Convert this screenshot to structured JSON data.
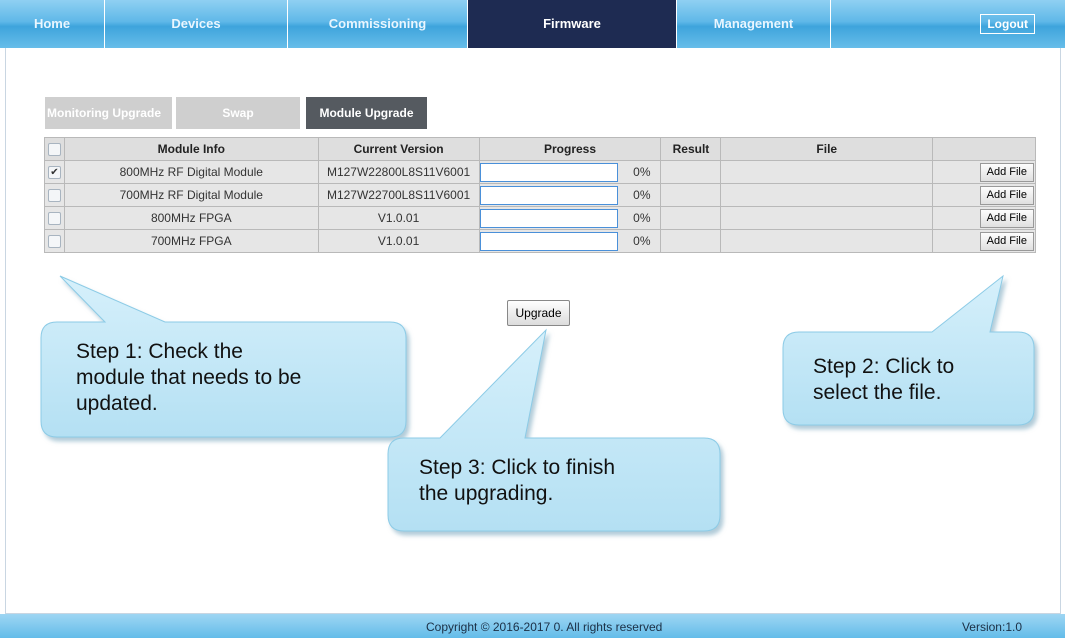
{
  "nav": {
    "home": "Home",
    "devices": "Devices",
    "commissioning": "Commissioning",
    "firmware": "Firmware",
    "management": "Management",
    "logout": "Logout"
  },
  "subtabs": [
    "Monitoring Upgrade",
    "Swap",
    "Module Upgrade"
  ],
  "table": {
    "headers": {
      "module_info": "Module Info",
      "current_version": "Current Version",
      "progress": "Progress",
      "result": "Result",
      "file": "File"
    },
    "rows": [
      {
        "checked": true,
        "module": "800MHz RF Digital Module",
        "version": "M127W22800L8S11V6001",
        "progress": "0%",
        "progress_fraction": 0,
        "result": "",
        "file": "",
        "add_file": "Add File"
      },
      {
        "checked": false,
        "module": "700MHz RF Digital Module",
        "version": "M127W22700L8S11V6001",
        "progress": "0%",
        "progress_fraction": 0,
        "result": "",
        "file": "",
        "add_file": "Add File"
      },
      {
        "checked": false,
        "module": "800MHz FPGA",
        "version": "V1.0.01",
        "progress": "0%",
        "progress_fraction": 0,
        "result": "",
        "file": "",
        "add_file": "Add File"
      },
      {
        "checked": false,
        "module": "700MHz FPGA",
        "version": "V1.0.01",
        "progress": "0%",
        "progress_fraction": 0,
        "result": "",
        "file": "",
        "add_file": "Add File"
      }
    ]
  },
  "upgrade_button": "Upgrade",
  "callouts": {
    "step1": [
      "Step 1: Check the",
      "module that needs to be",
      "updated."
    ],
    "step2": [
      "Step 2: Click to",
      "select the file."
    ],
    "step3": [
      "Step 3: Click to finish",
      "the upgrading."
    ]
  },
  "footer": {
    "copyright": "Copyright © 2016-2017 0. All rights reserved",
    "version": "Version:1.0"
  },
  "colors": {
    "nav_active": "#1e2b52",
    "callout_fill": "#c6e8f6",
    "progress_border": "#4a90d9"
  }
}
